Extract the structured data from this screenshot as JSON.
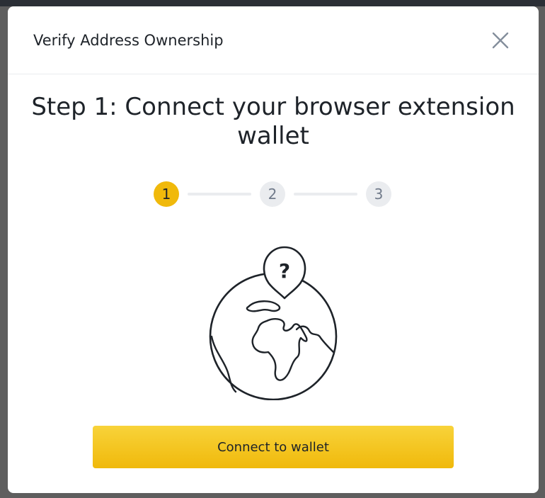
{
  "modal": {
    "title": "Verify Address Ownership",
    "close_icon": "close-icon"
  },
  "step": {
    "heading_line1": "Step 1: Connect your browser extension",
    "heading_line2": "wallet",
    "current": 1,
    "steps": [
      "1",
      "2",
      "3"
    ]
  },
  "illustration": {
    "icon": "globe-question-pin-icon",
    "pin_text": "?"
  },
  "actions": {
    "connect_label": "Connect to wallet"
  },
  "colors": {
    "accent": "#f0b90b",
    "text": "#1e2329",
    "muted": "#707a8a",
    "inactive_step": "#eaecef",
    "overlay": "#5e5e5e"
  }
}
